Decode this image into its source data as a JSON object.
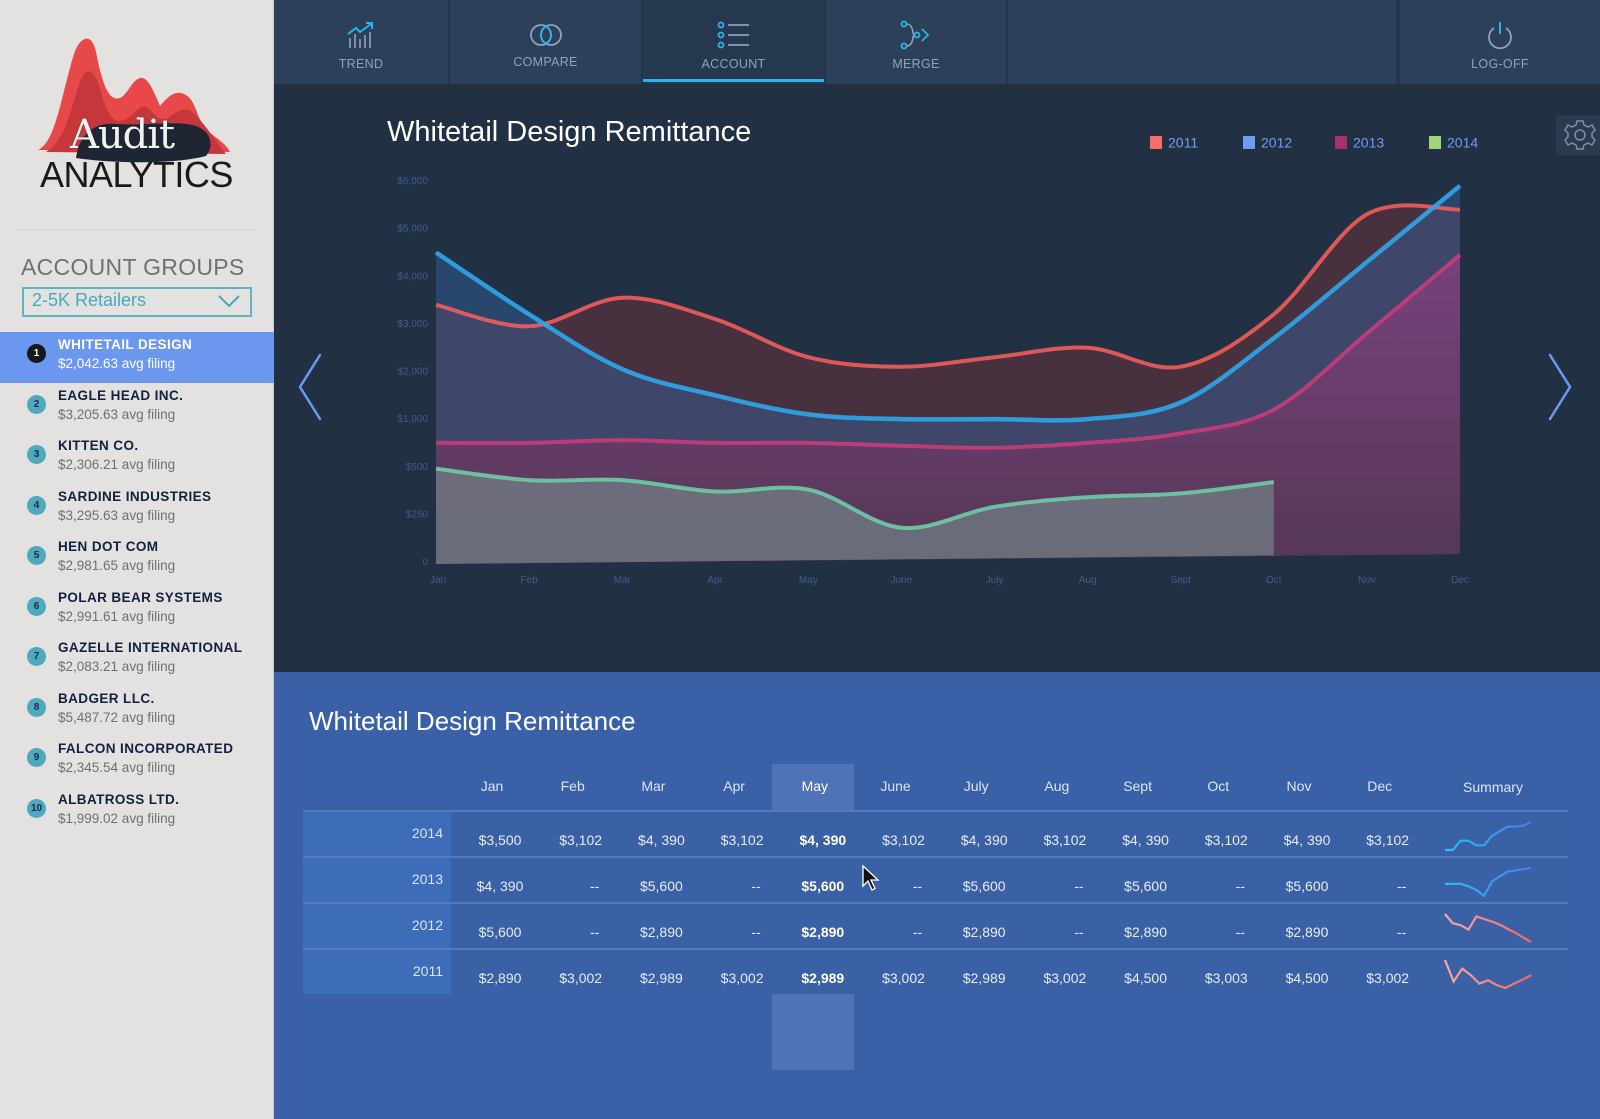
{
  "sidebar": {
    "logo": {
      "word1": "Audit",
      "word2": "ANALYTICS"
    },
    "groups_title": "ACCOUNT GROUPS",
    "group_select": {
      "value": "2-5K Retailers"
    },
    "accounts": [
      {
        "rank": "1",
        "name": "WHITETAIL DESIGN",
        "sub": "$2,042.63 avg filing",
        "active": true
      },
      {
        "rank": "2",
        "name": "EAGLE HEAD INC.",
        "sub": "$3,205.63 avg filing"
      },
      {
        "rank": "3",
        "name": "KITTEN CO.",
        "sub": "$2,306.21 avg filing"
      },
      {
        "rank": "4",
        "name": "SARDINE INDUSTRIES",
        "sub": "$3,295.63 avg filing"
      },
      {
        "rank": "5",
        "name": "HEN DOT COM",
        "sub": "$2,981.65 avg filing"
      },
      {
        "rank": "6",
        "name": "POLAR BEAR SYSTEMS",
        "sub": "$2,991.61 avg filing"
      },
      {
        "rank": "7",
        "name": "GAZELLE INTERNATIONAL",
        "sub": "$2,083.21 avg filing"
      },
      {
        "rank": "8",
        "name": "BADGER LLC.",
        "sub": "$5,487.72 avg filing"
      },
      {
        "rank": "9",
        "name": "FALCON INCORPORATED",
        "sub": "$2,345.54 avg filing"
      },
      {
        "rank": "10",
        "name": "ALBATROSS LTD.",
        "sub": "$1,999.02 avg filing"
      }
    ]
  },
  "nav": {
    "tabs": [
      {
        "label": "TREND",
        "icon": "trend-chart-icon"
      },
      {
        "label": "COMPARE",
        "icon": "overlap-circles-icon"
      },
      {
        "label": "ACCOUNT",
        "icon": "list-icon",
        "active": true
      },
      {
        "label": "MERGE",
        "icon": "merge-icon"
      },
      {
        "label": "LOG-OFF",
        "icon": "power-icon"
      }
    ]
  },
  "colors": {
    "accent": "#2bb4ea",
    "sidebar_active": "#6c97ee",
    "chart_bg": "#213043",
    "table_bg": "#3a61a8"
  },
  "chart_data": {
    "type": "area",
    "title": "Whitetail Design Remittance",
    "xlabel": "",
    "ylabel": "",
    "categories": [
      "Jan",
      "Feb",
      "Mar",
      "Apr",
      "May",
      "June",
      "July",
      "Aug",
      "Sept",
      "Oct",
      "Nov",
      "Dec"
    ],
    "y_ticks": [
      "0",
      "$250",
      "$500",
      "$1,000",
      "$2,000",
      "$3,000",
      "$4,000",
      "$5,000",
      "$6,000"
    ],
    "y_tick_values": [
      0,
      250,
      500,
      1000,
      2000,
      3000,
      4000,
      5000,
      6000
    ],
    "y_scale": "piecewise-even-ticks",
    "ylim": [
      0,
      6000
    ],
    "grid": false,
    "legend_position": "top-right",
    "series": [
      {
        "name": "2011",
        "color": "#f25c5c",
        "values": [
          3400,
          2950,
          3550,
          3100,
          2300,
          2100,
          2300,
          2500,
          2100,
          3200,
          5300,
          5400
        ]
      },
      {
        "name": "2012",
        "color": "#2fa6ea",
        "values": [
          4500,
          3200,
          2050,
          1500,
          1100,
          1000,
          1000,
          1000,
          1350,
          2700,
          4300,
          5900
        ]
      },
      {
        "name": "2013",
        "color": "#c73c78",
        "values": [
          750,
          750,
          780,
          750,
          750,
          720,
          700,
          750,
          850,
          1200,
          2800,
          4450
        ]
      },
      {
        "name": "2014",
        "color": "#6dcca6",
        "values": [
          490,
          430,
          430,
          370,
          380,
          180,
          290,
          340,
          360,
          420,
          null,
          null
        ]
      }
    ]
  },
  "table": {
    "title": "Whitetail Design Remittance",
    "columns": [
      "Jan",
      "Feb",
      "Mar",
      "Apr",
      "May",
      "June",
      "July",
      "Aug",
      "Sept",
      "Oct",
      "Nov",
      "Dec"
    ],
    "summary_label": "Summary",
    "highlighted_column": "May",
    "rows": [
      {
        "year": "2014",
        "cells": [
          "$3,500",
          "$3,102",
          "$4, 390",
          "$3,102",
          "$4, 390",
          "$3,102",
          "$4, 390",
          "$3,102",
          "$4, 390",
          "$3,102",
          "$4, 390",
          "$3,102"
        ],
        "spark": [
          1,
          1,
          3,
          3,
          2,
          2,
          4,
          5,
          6,
          6,
          6.2,
          7
        ],
        "spark_colors": [
          "#2bc0f0",
          "#4a7bf0"
        ]
      },
      {
        "year": "2013",
        "cells": [
          "$4, 390",
          "--",
          "$5,600",
          "--",
          "$5,600",
          "--",
          "$5,600",
          "--",
          "$5,600",
          "--",
          "$5,600",
          "--"
        ],
        "spark": [
          3,
          3,
          3,
          2.8,
          2.5,
          2,
          3.2,
          3.6,
          4,
          4.1,
          4.2,
          4.3
        ],
        "spark_colors": [
          "#2bc0f0",
          "#4a7bf0"
        ]
      },
      {
        "year": "2012",
        "cells": [
          "$5,600",
          "--",
          "$2,890",
          "--",
          "$2,890",
          "--",
          "$2,890",
          "--",
          "$2,890",
          "--",
          "$2,890",
          "--"
        ],
        "spark": [
          6,
          4.5,
          4.2,
          3.5,
          5.6,
          5.2,
          4.8,
          4.3,
          3.6,
          3,
          2.2,
          1.5
        ],
        "spark_colors": [
          "#f7a7a0",
          "#f26a62"
        ]
      },
      {
        "year": "2011",
        "cells": [
          "$2,890",
          "$3,002",
          "$2,989",
          "$3,002",
          "$2,989",
          "$3,002",
          "$2,989",
          "$3,002",
          "$4,500",
          "$3,003",
          "$4,500",
          "$3,002"
        ],
        "spark": [
          7,
          2,
          5,
          3.5,
          1.5,
          2.3,
          1.2,
          0.5,
          1.5,
          2.4,
          3.5
        ],
        "spark_colors": [
          "#f7a7a0",
          "#f26a62"
        ]
      }
    ]
  }
}
